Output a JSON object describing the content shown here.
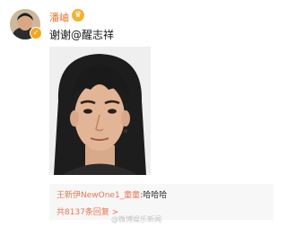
{
  "post": {
    "username": "潘岫",
    "text_prefix": "谢谢",
    "mention": "@醒志祥"
  },
  "comment": {
    "author": "王新伊NewOne1_童童",
    "separator": ":",
    "body": "哈哈哈",
    "reply_count": "共8137条回复 >"
  },
  "watermark": "@微博娱乐新闻",
  "colors": {
    "username": "#e8732a",
    "comment_author": "#eb7350",
    "comment_bg": "#f7f7f7"
  },
  "icons": [
    "avatar",
    "verified-badge-icon",
    "crown-icon"
  ]
}
